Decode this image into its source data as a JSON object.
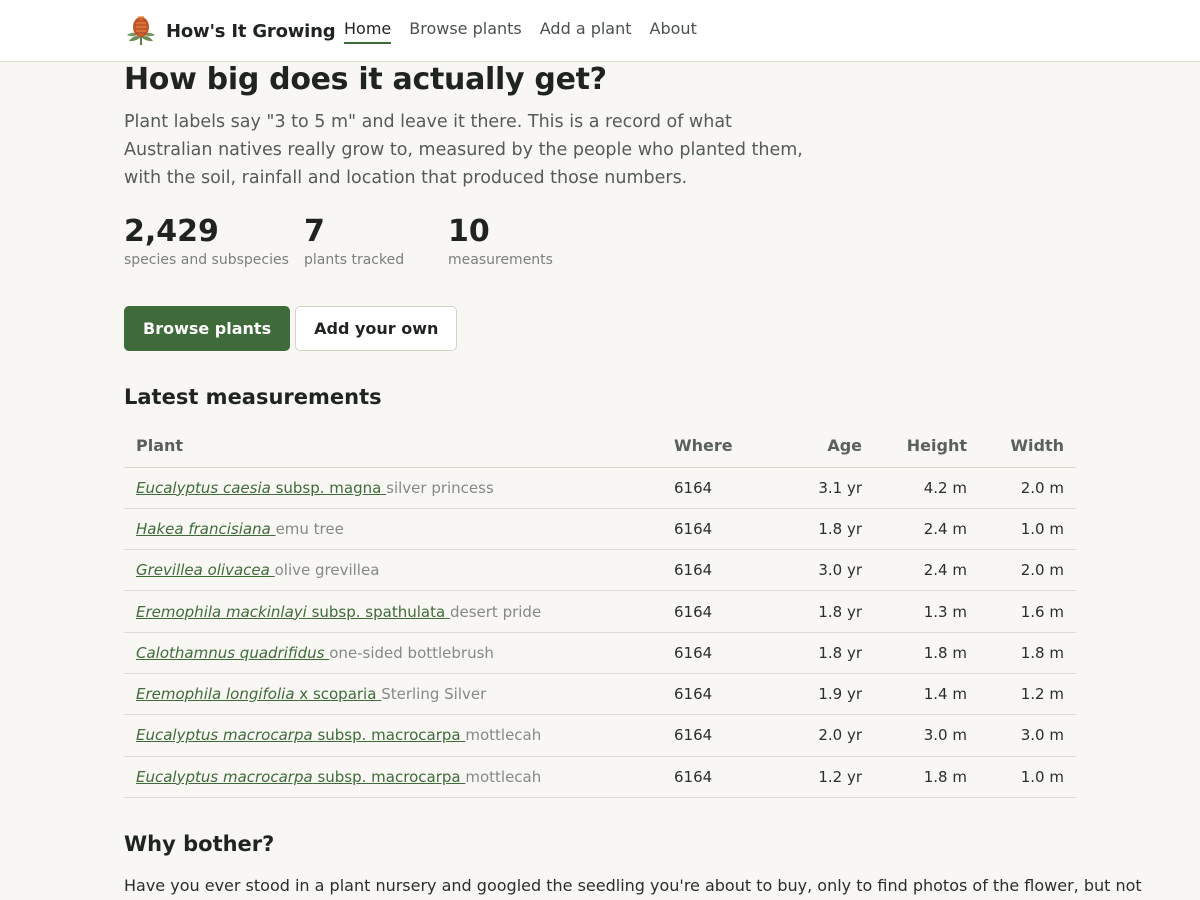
{
  "header": {
    "brand": "How's It Growing",
    "nav": [
      "Home",
      "Browse plants",
      "Add a plant",
      "About"
    ]
  },
  "hero": {
    "title": "How big does it actually get?",
    "lead": "Plant labels say \"3 to 5 m\" and leave it there. This is a record of what Australian natives really grow to, measured by the people who planted them, with the soil, rainfall and location that produced those numbers."
  },
  "stats": [
    {
      "value": "2,429",
      "label": "species and subspecies"
    },
    {
      "value": "7",
      "label": "plants tracked"
    },
    {
      "value": "10",
      "label": "measurements"
    }
  ],
  "buttons": {
    "primary": "Browse plants",
    "secondary": "Add your own"
  },
  "latest": {
    "title": "Latest measurements",
    "columns": [
      "Plant",
      "Where",
      "Age",
      "Height",
      "Width"
    ],
    "rows": [
      {
        "genus": "Eucalyptus caesia",
        "qualifier": "subsp. magna",
        "common": "silver princess",
        "where": "6164",
        "age": "3.1 yr",
        "height": "4.2 m",
        "width": "2.0 m"
      },
      {
        "genus": "Hakea francisiana",
        "qualifier": "",
        "common": "emu tree",
        "where": "6164",
        "age": "1.8 yr",
        "height": "2.4 m",
        "width": "1.0 m"
      },
      {
        "genus": "Grevillea olivacea",
        "qualifier": "",
        "common": "olive grevillea",
        "where": "6164",
        "age": "3.0 yr",
        "height": "2.4 m",
        "width": "2.0 m"
      },
      {
        "genus": "Eremophila mackinlayi",
        "qualifier": "subsp. spathulata",
        "common": "desert pride",
        "where": "6164",
        "age": "1.8 yr",
        "height": "1.3 m",
        "width": "1.6 m"
      },
      {
        "genus": "Calothamnus quadrifidus",
        "qualifier": "",
        "common": "one-sided bottlebrush",
        "where": "6164",
        "age": "1.8 yr",
        "height": "1.8 m",
        "width": "1.8 m"
      },
      {
        "genus": "Eremophila longifolia",
        "qualifier": "x scoparia",
        "common": "Sterling Silver",
        "where": "6164",
        "age": "1.9 yr",
        "height": "1.4 m",
        "width": "1.2 m"
      },
      {
        "genus": "Eucalyptus macrocarpa",
        "qualifier": "subsp. macrocarpa",
        "common": "mottlecah",
        "where": "6164",
        "age": "2.0 yr",
        "height": "3.0 m",
        "width": "3.0 m"
      },
      {
        "genus": "Eucalyptus macrocarpa",
        "qualifier": "subsp. macrocarpa",
        "common": "mottlecah",
        "where": "6164",
        "age": "1.2 yr",
        "height": "1.8 m",
        "width": "1.0 m"
      }
    ]
  },
  "why": {
    "title": "Why bother?",
    "text": "Have you ever stood in a plant nursery and googled the seedling you're about to buy, only to find photos of the flower, but not"
  },
  "colors": {
    "accent": "#3f6b3a",
    "background": "#f8f7f3",
    "muted": "#858a85"
  },
  "icons": {
    "logo": "banksia-flower-icon"
  }
}
